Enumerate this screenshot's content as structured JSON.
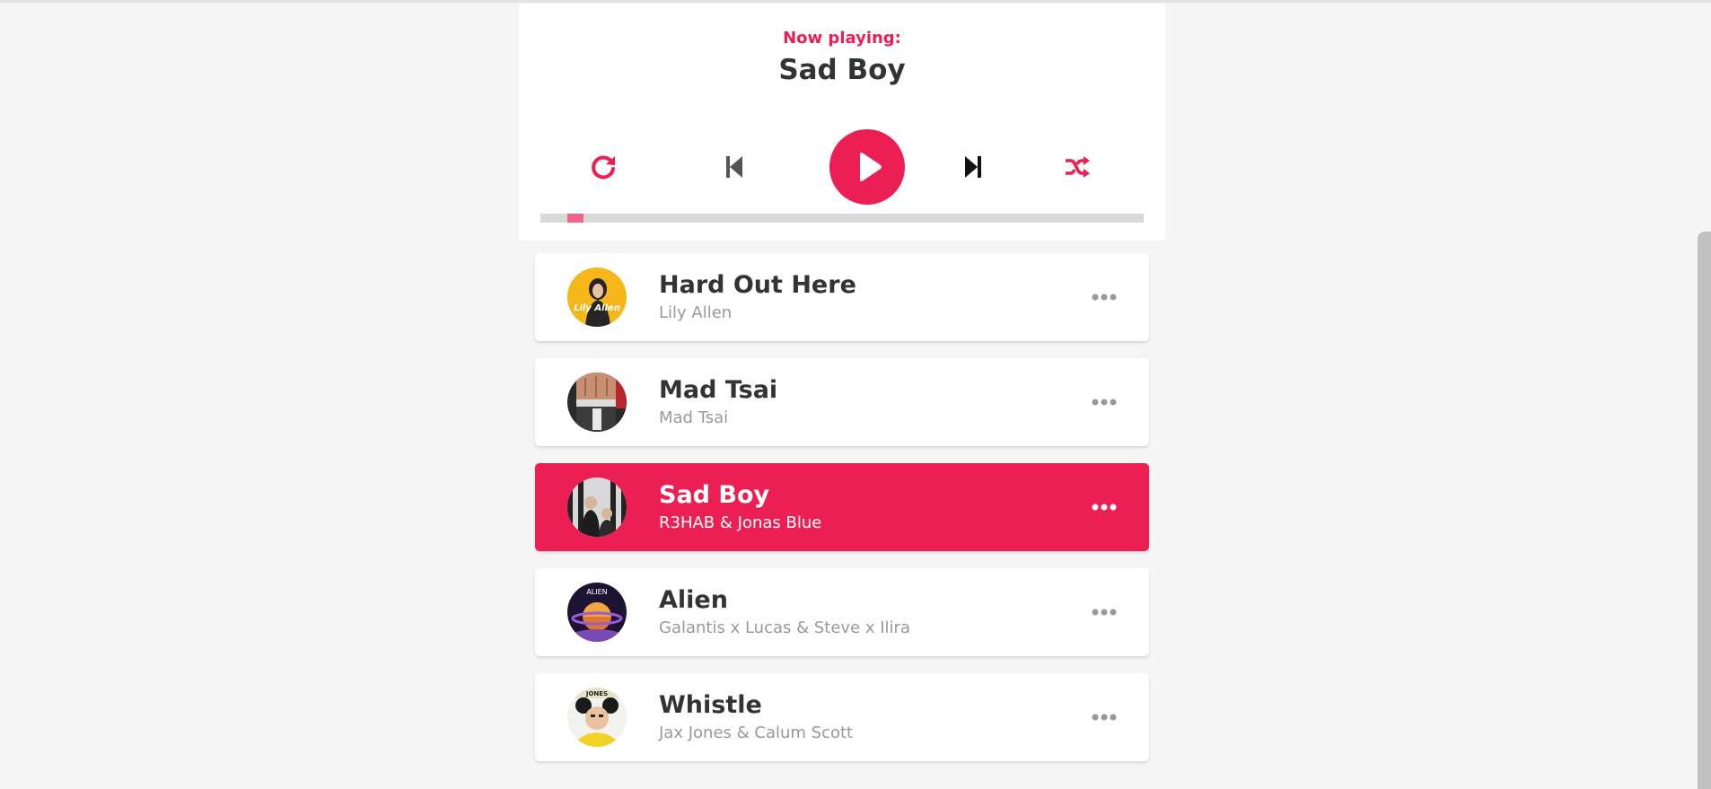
{
  "header": {
    "now_playing_label": "Now playing:",
    "current_title": "Sad Boy"
  },
  "controls": {
    "repeat_icon": "repeat-icon",
    "prev_icon": "step-backward-icon",
    "play_icon": "play-icon",
    "next_icon": "step-forward-icon",
    "random_icon": "shuffle-icon",
    "accent_color": "#ec1f55"
  },
  "progress": {
    "value_percent": 3
  },
  "playlist": [
    {
      "title": "Hard Out Here",
      "author": "Lily Allen",
      "active": false
    },
    {
      "title": "Mad Tsai",
      "author": "Mad Tsai",
      "active": false
    },
    {
      "title": "Sad Boy",
      "author": "R3HAB & Jonas Blue",
      "active": true
    },
    {
      "title": "Alien",
      "author": "Galantis x Lucas & Steve x Ilira",
      "active": false
    },
    {
      "title": "Whistle",
      "author": "Jax Jones & Calum Scott",
      "active": false
    }
  ],
  "thumb_art": [
    "Lily Allen",
    "",
    "",
    "ALIEN",
    "JONES"
  ]
}
